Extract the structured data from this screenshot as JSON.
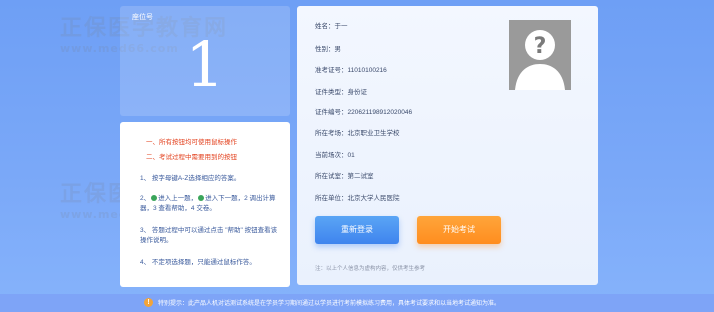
{
  "seat": {
    "label": "座位号",
    "number": "1"
  },
  "notice": {
    "red1": "一、所有按钮均可使用鼠标操作",
    "red2": "二、考试过程中需要用到的按钮",
    "item1": "1、 按字母键A-Z选择相应的答案。",
    "item2_a": "2、",
    "item2_b": "进入上一题，",
    "item2_c": "进入下一题，2 调出计算器，3 查看帮助，4 交卷。",
    "item3": "3、 答题过程中可以通过点击 \"帮助\" 按钮查看该操作说明。",
    "item4": "4、 不定项选择题，只能通过鼠标作答。"
  },
  "info": {
    "name_k": "姓名：",
    "name_v": "于一",
    "gender_k": "性别：",
    "gender_v": "男",
    "ticket_k": "准考证号：",
    "ticket_v": "11010100216",
    "idtype_k": "证件类型：",
    "idtype_v": "身份证",
    "idno_k": "证件编号：",
    "idno_v": "220621198912020046",
    "site_k": "所在考场：",
    "site_v": "北京职业卫生学校",
    "session_k": "当前场次：",
    "session_v": "01",
    "room_k": "所在试室：",
    "room_v": "第二试室",
    "unit_k": "所在单位：",
    "unit_v": "北京大学人民医院"
  },
  "buttons": {
    "relogin": "重新登录",
    "start": "开始考试"
  },
  "note": "注：以上个人信息为虚构内容，仅供考生参考",
  "footer": {
    "warn_icon": "!",
    "text": "特别提示：此产品人机对话测试系统是在学员学习期间通过以学员进行考前模拟练习费用，具体考试要求和以当地考试通知为准。"
  },
  "watermark": {
    "brand": "正保医学教育网",
    "url": "www.med66.com"
  }
}
